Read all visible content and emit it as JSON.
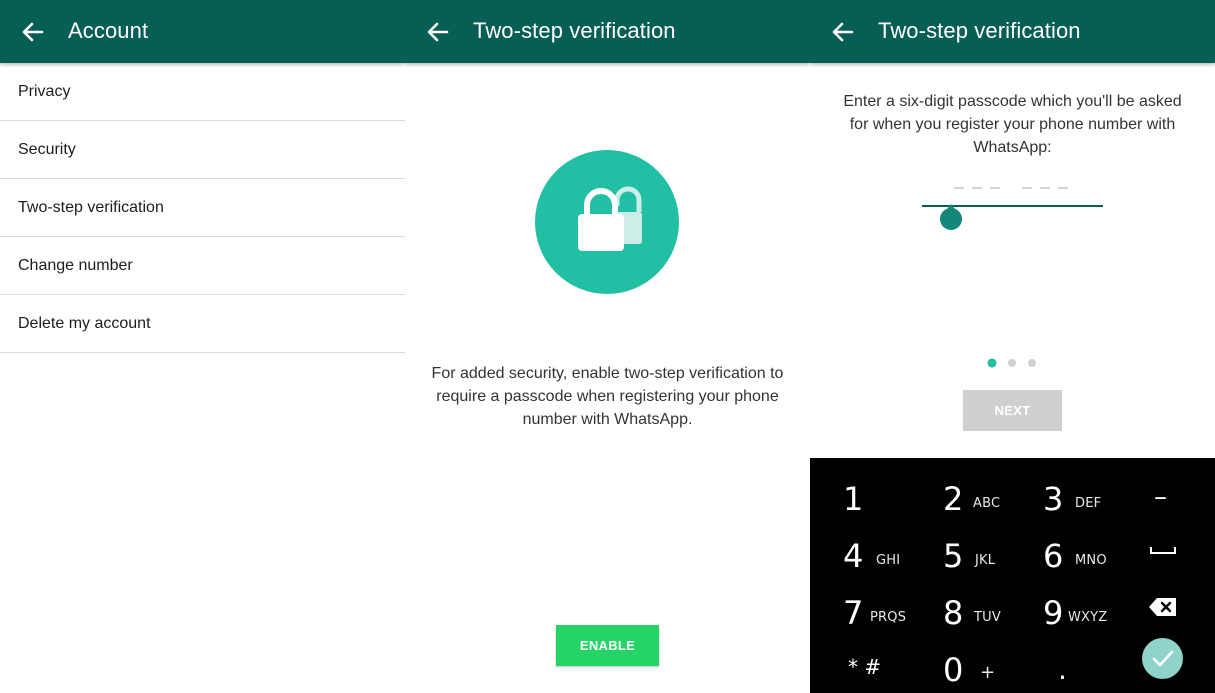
{
  "account_screen": {
    "title": "Account",
    "items": [
      {
        "label": "Privacy"
      },
      {
        "label": "Security"
      },
      {
        "label": "Two-step verification"
      },
      {
        "label": "Change number"
      },
      {
        "label": "Delete my account"
      }
    ]
  },
  "intro_screen": {
    "title": "Two-step verification",
    "icon": "lock-icon",
    "description": "For added security, enable two-step verification to require a passcode when registering your phone number with WhatsApp.",
    "enable_label": "ENABLE"
  },
  "passcode_screen": {
    "title": "Two-step verification",
    "prompt": "Enter a six-digit passcode which you'll be asked for when you register your phone number with WhatsApp:",
    "passcode_value": "",
    "passcode_placeholder": "___ ___",
    "page_indicator": {
      "total": 3,
      "active": 1
    },
    "next_label": "NEXT"
  },
  "keypad": {
    "keys": [
      {
        "digit": "1",
        "letters": ""
      },
      {
        "digit": "2",
        "letters": "ABC"
      },
      {
        "digit": "3",
        "letters": "DEF"
      },
      {
        "digit": "4",
        "letters": "GHI"
      },
      {
        "digit": "5",
        "letters": "JKL"
      },
      {
        "digit": "6",
        "letters": "MNO"
      },
      {
        "digit": "7",
        "letters": "PRQS"
      },
      {
        "digit": "8",
        "letters": "TUV"
      },
      {
        "digit": "9",
        "letters": "WXYZ"
      },
      {
        "digit": "0",
        "letters": "+"
      }
    ],
    "minus_key": "–",
    "star_hash_key": "* #",
    "period_key": ".",
    "space_key": "space-icon",
    "backspace_key": "backspace-icon",
    "done_key": "checkmark-icon"
  },
  "colors": {
    "toolbar": "#075e54",
    "accent": "#21c0a5",
    "button_green": "#25d366",
    "disabled": "#cfcfcf",
    "keypad_bg": "#000000",
    "done_fab": "#8fd3c9"
  }
}
